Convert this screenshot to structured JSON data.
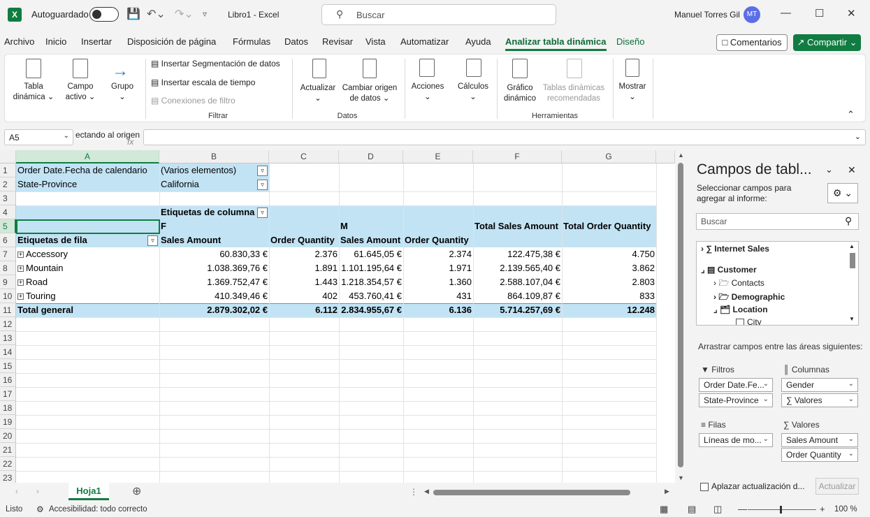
{
  "titlebar": {
    "app_initial": "X",
    "autosave_label": "Autoguardado",
    "filename": "Libro1  -  Excel",
    "search_placeholder": "Buscar",
    "user_name": "Manuel Torres Gil",
    "user_initials": "MT"
  },
  "menu": {
    "items": [
      "Archivo",
      "Inicio",
      "Insertar",
      "Disposición de página",
      "Fórmulas",
      "Datos",
      "Revisar",
      "Vista",
      "Automatizar",
      "Ayuda",
      "Analizar tabla dinámica",
      "Diseño"
    ],
    "comments_label": "Comentarios",
    "share_label": "Compartir"
  },
  "ribbon": {
    "tabla_dinamica": "Tabla\ndinámica ⌄",
    "campo_activo": "Campo\nactivo ⌄",
    "grupo": "Grupo\n⌄",
    "insert_slicer": "Insertar Segmentación de datos",
    "insert_timeline": "Insertar escala de tiempo",
    "filter_connections": "Conexiones de filtro",
    "group_filtrar": "Filtrar",
    "actualizar": "Actualizar\n⌄",
    "cambiar_origen": "Cambiar origen\nde datos ⌄",
    "group_datos": "Datos",
    "acciones": "Acciones\n⌄",
    "calculos": "Cálculos\n⌄",
    "grafico_dinamico": "Gráfico\ndinámico",
    "tablas_recomendadas": "Tablas dinámicas\nrecomendadas",
    "group_herramientas": "Herramientas",
    "mostrar": "Mostrar\n⌄"
  },
  "formula_bar": {
    "name_box": "A5",
    "tooltip_text": "ectando al origen",
    "fx": "fx",
    "formula": ""
  },
  "grid": {
    "columns": [
      "A",
      "B",
      "C",
      "D",
      "E",
      "F",
      "G"
    ],
    "rows": [
      "1",
      "2",
      "3",
      "4",
      "5",
      "6",
      "7",
      "8",
      "9",
      "10",
      "11",
      "12",
      "13",
      "14",
      "15",
      "16",
      "17",
      "18",
      "19",
      "20",
      "21",
      "22",
      "23"
    ],
    "pivot": {
      "filter1_label": "Order Date.Fecha de calendario",
      "filter1_value": "(Varios elementos)",
      "filter2_label": "State-Province",
      "filter2_value": "California",
      "column_labels": "Etiquetas de columna",
      "col_group_f": "F",
      "col_group_m": "M",
      "total_sales_amount": "Total Sales Amount",
      "total_order_quantity": "Total Order Quantity",
      "row_labels": "Etiquetas de fila",
      "hdr_sales_amount": "Sales Amount",
      "hdr_order_quantity": "Order Quantity",
      "hdr_sales_amount_m": "Sales Amount",
      "hdr_order_quantity_m": "Order Quantity",
      "data_rows": [
        {
          "label": "Accessory",
          "f_sales": "60.830,33 €",
          "f_qty": "2.376",
          "m_sales": "61.645,05 €",
          "m_qty": "2.374",
          "t_sales": "122.475,38 €",
          "t_qty": "4.750"
        },
        {
          "label": "Mountain",
          "f_sales": "1.038.369,76 €",
          "f_qty": "1.891",
          "m_sales": "1.101.195,64 €",
          "m_qty": "1.971",
          "t_sales": "2.139.565,40 €",
          "t_qty": "3.862"
        },
        {
          "label": "Road",
          "f_sales": "1.369.752,47 €",
          "f_qty": "1.443",
          "m_sales": "1.218.354,57 €",
          "m_qty": "1.360",
          "t_sales": "2.588.107,04 €",
          "t_qty": "2.803"
        },
        {
          "label": "Touring",
          "f_sales": "410.349,46 €",
          "f_qty": "402",
          "m_sales": "453.760,41 €",
          "m_qty": "431",
          "t_sales": "864.109,87 €",
          "t_qty": "833"
        }
      ],
      "total": {
        "label": "Total general",
        "f_sales": "2.879.302,02 €",
        "f_qty": "6.112",
        "m_sales": "2.834.955,67 €",
        "m_qty": "6.136",
        "t_sales": "5.714.257,69 €",
        "t_qty": "12.248"
      }
    }
  },
  "sheet_tabs": {
    "active": "Hoja1"
  },
  "status": {
    "ready": "Listo",
    "accessibility": "Accesibilidad: todo correcto",
    "zoom": "100 %"
  },
  "field_panel": {
    "title": "Campos de tabl...",
    "subtitle": "Seleccionar campos para agregar al informe:",
    "search_placeholder": "Buscar",
    "tree": [
      {
        "label": "Internet Sales",
        "bold": true
      },
      {
        "label": "Customer",
        "bold": true
      },
      {
        "label": "Contacts",
        "bold": false
      },
      {
        "label": "Demographic",
        "bold": true
      },
      {
        "label": "Location",
        "bold": true
      },
      {
        "label": "City",
        "bold": false
      }
    ],
    "drag_hint": "Arrastrar campos entre las áreas siguientes:",
    "area_filtros": "Filtros",
    "area_columnas": "Columnas",
    "area_filas": "Filas",
    "area_valores": "Valores",
    "filtros_items": [
      "Order Date.Fe...",
      "State-Province"
    ],
    "columnas_items": [
      "Gender",
      "∑ Valores"
    ],
    "filas_items": [
      "Líneas de mo..."
    ],
    "valores_items": [
      "Sales Amount",
      "Order Quantity"
    ],
    "defer_label": "Aplazar actualización d...",
    "update_button": "Actualizar"
  }
}
